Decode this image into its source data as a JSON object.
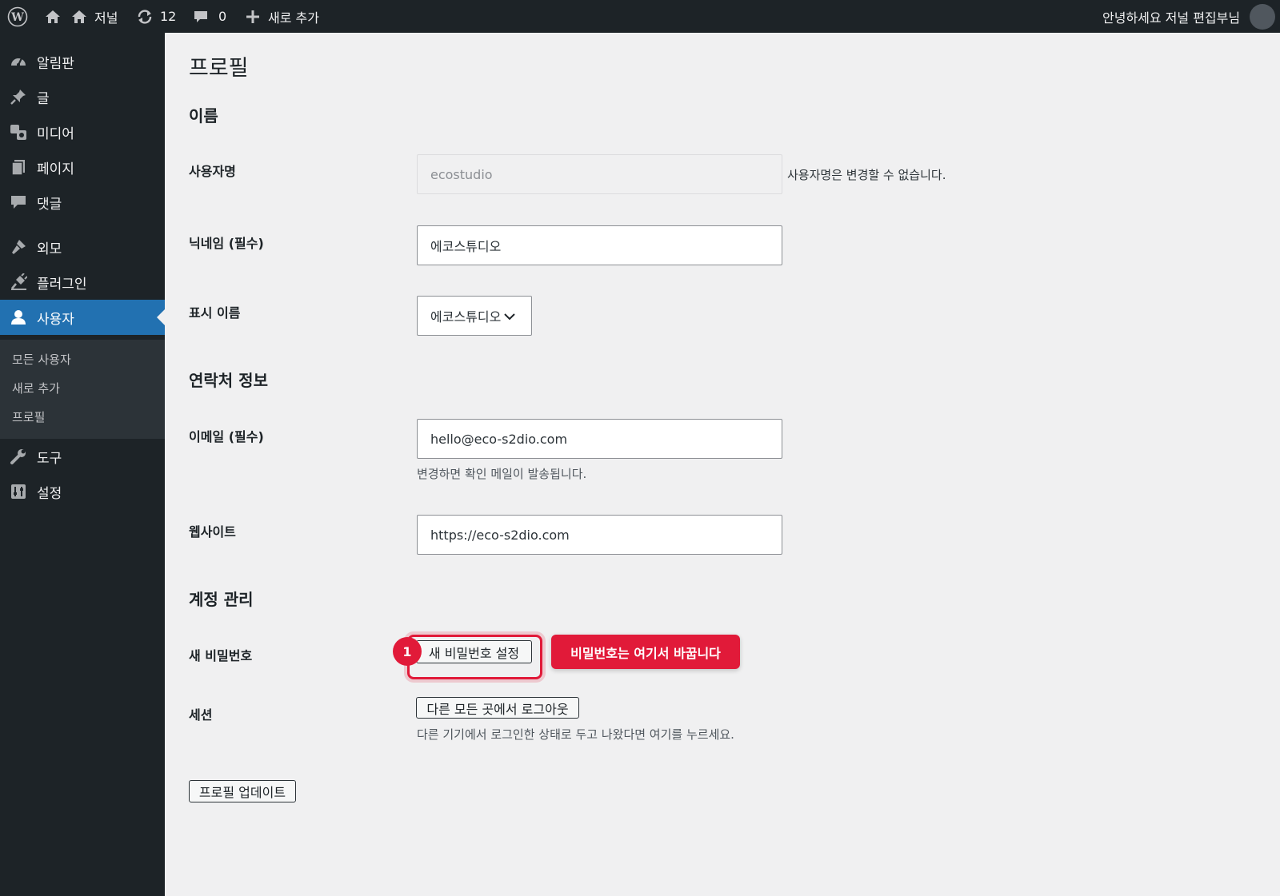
{
  "adminbar": {
    "site_name": "저널",
    "updates_count": "12",
    "comments_count": "0",
    "new_label": "새로 추가",
    "greeting": "안녕하세요 저널 편집부님"
  },
  "sidebar": {
    "items": [
      {
        "label": "알림판",
        "icon": "dashboard-icon"
      },
      {
        "label": "글",
        "icon": "pin-icon"
      },
      {
        "label": "미디어",
        "icon": "media-icon"
      },
      {
        "label": "페이지",
        "icon": "page-icon"
      },
      {
        "label": "댓글",
        "icon": "comment-icon"
      },
      {
        "label": "외모",
        "icon": "brush-icon"
      },
      {
        "label": "플러그인",
        "icon": "plugin-icon"
      },
      {
        "label": "사용자",
        "icon": "user-icon"
      },
      {
        "label": "도구",
        "icon": "wrench-icon"
      },
      {
        "label": "설정",
        "icon": "settings-icon"
      }
    ],
    "submenu": [
      "모든 사용자",
      "새로 추가",
      "프로필"
    ]
  },
  "page": {
    "title": "프로필",
    "section_name": "이름",
    "username_label": "사용자명",
    "username_value": "ecostudio",
    "username_note": "사용자명은 변경할 수 없습니다.",
    "nickname_label": "닉네임 (필수)",
    "nickname_value": "에코스튜디오",
    "display_label": "표시 이름",
    "display_value": "에코스튜디오",
    "section_contact": "연락처 정보",
    "email_label": "이메일 (필수)",
    "email_value": "hello@eco-s2dio.com",
    "email_note": "변경하면 확인 메일이 발송됩니다.",
    "website_label": "웹사이트",
    "website_value": "https://eco-s2dio.com",
    "section_account": "계정 관리",
    "password_label": "새 비밀번호",
    "password_button": "새 비밀번호 설정",
    "sessions_label": "세션",
    "logout_button": "다른 모든 곳에서 로그아웃",
    "sessions_note": "다른 기기에서 로그인한 상태로 두고 나왔다면 여기를 누르세요.",
    "update_button": "프로필 업데이트"
  },
  "annotation": {
    "step": "1",
    "callout": "비밀번호는 여기서 바꿉니다"
  },
  "colors": {
    "admin_dark": "#1d2327",
    "accent_blue": "#2271b1",
    "highlight_red": "#e11a39"
  }
}
